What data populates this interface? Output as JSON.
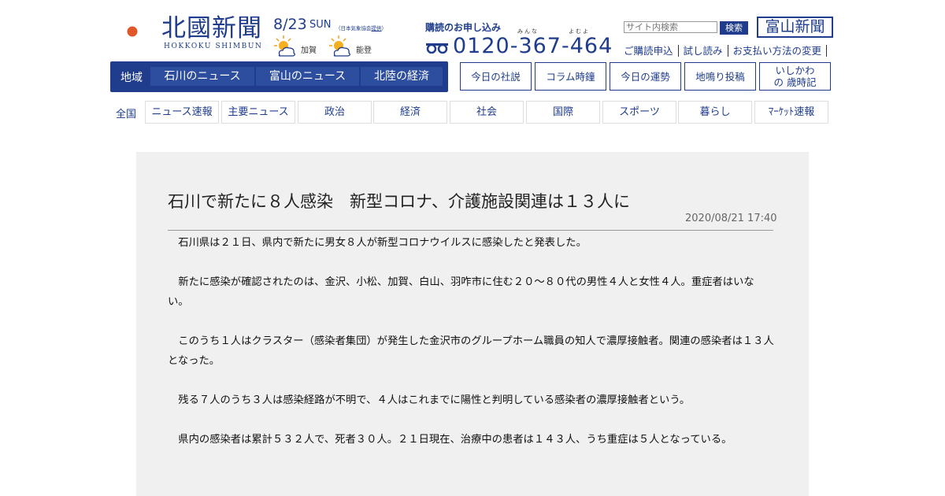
{
  "header": {
    "logo_jp": "北國新聞",
    "logo_en": "HOKKOKU SHIMBUN",
    "brand_color": "#1f3d8c"
  },
  "weather": {
    "date": "8/23",
    "day": "SUN",
    "provider_prefix": "（日本気象協会",
    "provider_link": "提供",
    "provider_suffix": "）",
    "regions": [
      {
        "name": "加賀",
        "icon": "sunny-cloudy-icon"
      },
      {
        "name": "能登",
        "icon": "sunny-cloudy-icon"
      }
    ]
  },
  "subscription": {
    "title": "購読のお申し込み",
    "phone": "0120-367-464",
    "ruby_1": "みんな",
    "ruby_2": "よむよ",
    "links": [
      "ご購読申込",
      "試し読み",
      "お支払い方法の変更"
    ]
  },
  "search": {
    "placeholder": "サイト内検索",
    "button": "検索"
  },
  "toyama_logo": "富山新聞",
  "region_nav": {
    "label": "地域",
    "tabs": [
      "石川のニュース",
      "富山のニュース",
      "北陸の経済"
    ]
  },
  "feature_nav": [
    "今日の社説",
    "コラム時鐘",
    "今日の運勢",
    "地鳴り投稿",
    "いしかわの 歳時記"
  ],
  "category_nav": {
    "label": "全国",
    "items": [
      "ニュース速報",
      "主要ニュース",
      "政治",
      "経済",
      "社会",
      "国際",
      "スポーツ",
      "暮らし",
      "ﾏｰｹｯﾄ速報"
    ]
  },
  "article": {
    "title": "石川で新たに８人感染　新型コロナ、介護施設関連は１３人に",
    "date": "2020/08/21 17:40",
    "paragraphs": [
      "石川県は２１日、県内で新たに男女８人が新型コロナウイルスに感染したと発表した。",
      "新たに感染が確認されたのは、金沢、小松、加賀、白山、羽咋市に住む２０～８０代の男性４人と女性４人。重症者はいない。",
      "このうち１人はクラスター（感染者集団）が発生した金沢市のグループホーム職員の知人で濃厚接触者。関連の感染者は１３人となった。",
      "残る７人のうち３人は感染経路が不明で、４人はこれまでに陽性と判明している感染者の濃厚接触者という。",
      "県内の感染者は累計５３２人で、死者３０人。２１日現在、治療中の患者は１４３人、うち重症は５人となっている。"
    ]
  }
}
